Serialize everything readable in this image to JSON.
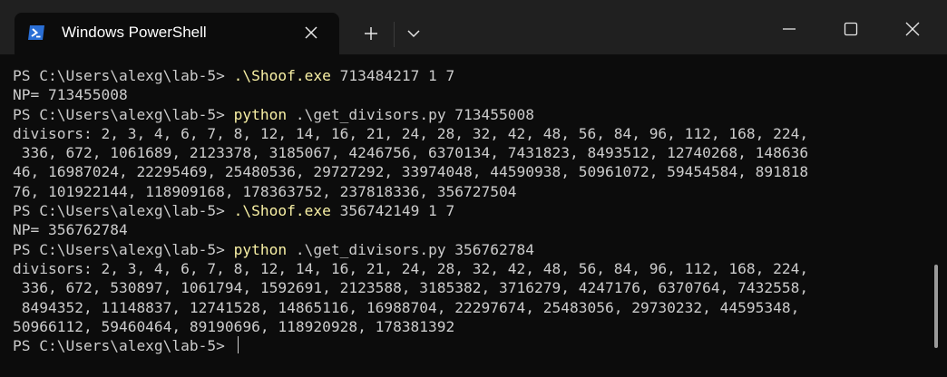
{
  "window": {
    "tab_title": "Windows PowerShell",
    "icons": {
      "app": "powershell-icon",
      "tab_close": "close-icon",
      "new_tab": "plus-icon",
      "dropdown": "chevron-down-icon",
      "minimize": "minimize-icon",
      "maximize": "maximize-icon",
      "close": "close-icon"
    }
  },
  "colors": {
    "background": "#0c0c0c",
    "titlebar": "#202020",
    "text": "#cccccc",
    "command": "#f9f1a5",
    "ps_icon": "#2a6fd6"
  },
  "terminal": {
    "lines": [
      {
        "prompt": "PS C:\\Users\\alexg\\lab-5> ",
        "cmd": ".\\Shoof.exe",
        "args": " 713484217 1 7"
      },
      {
        "text": "NP= 713455008"
      },
      {
        "prompt": "PS C:\\Users\\alexg\\lab-5> ",
        "cmd": "python",
        "args": " .\\get_divisors.py 713455008"
      },
      {
        "text": "divisors: 2, 3, 4, 6, 7, 8, 12, 14, 16, 21, 24, 28, 32, 42, 48, 56, 84, 96, 112, 168, 224,"
      },
      {
        "text": " 336, 672, 1061689, 2123378, 3185067, 4246756, 6370134, 7431823, 8493512, 12740268, 148636"
      },
      {
        "text": "46, 16987024, 22295469, 25480536, 29727292, 33974048, 44590938, 50961072, 59454584, 891818"
      },
      {
        "text": "76, 101922144, 118909168, 178363752, 237818336, 356727504"
      },
      {
        "prompt": "PS C:\\Users\\alexg\\lab-5> ",
        "cmd": ".\\Shoof.exe",
        "args": " 356742149 1 7"
      },
      {
        "text": "NP= 356762784"
      },
      {
        "prompt": "PS C:\\Users\\alexg\\lab-5> ",
        "cmd": "python",
        "args": " .\\get_divisors.py 356762784"
      },
      {
        "text": "divisors: 2, 3, 4, 6, 7, 8, 12, 14, 16, 21, 24, 28, 32, 42, 48, 56, 84, 96, 112, 168, 224,"
      },
      {
        "text": " 336, 672, 530897, 1061794, 1592691, 2123588, 3185382, 3716279, 4247176, 6370764, 7432558,"
      },
      {
        "text": " 8494352, 11148837, 12741528, 14865116, 16988704, 22297674, 25483056, 29730232, 44595348,"
      },
      {
        "text": "50966112, 59460464, 89190696, 118920928, 178381392"
      },
      {
        "prompt": "PS C:\\Users\\alexg\\lab-5> ",
        "cursor": true
      }
    ]
  }
}
